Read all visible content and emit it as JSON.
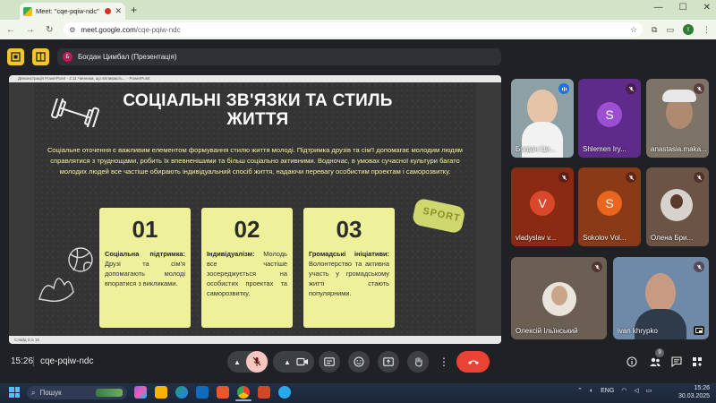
{
  "browser": {
    "tab_title": "Meet: \"cqe-pqiw-ndc\"",
    "new_tab": "+",
    "window_controls": [
      "—",
      "☐",
      "✕"
    ],
    "url_host": "meet.google.com",
    "url_path": "/cqe-pqiw-ndc",
    "profile_initial": "I"
  },
  "meet": {
    "presenter_initial": "Б",
    "presenter_label": "Богдан Цимбал (Презентація)",
    "clock": "15:26",
    "meeting_code": "cqe-pqiw-ndc",
    "people_count": "9"
  },
  "slide": {
    "powerpoint_title": "Демонстрація PowerPoint - 2.11 Чинники, що впливають... - PowerPoint",
    "status_bar": "Слайд 3 із 15",
    "title": "СОЦІАЛЬНІ ЗВ'ЯЗКИ ТА СТИЛЬ ЖИТТЯ",
    "body": "Соціальне оточення є важливим елементом формування стилю життя молоді. Підтримка друзів та сім'ї допомагає молодим людям справлятися з труднощами, робить їх впевненішими та більш соціально активними. Водночас, в умовах сучасної культури багато молодих людей все частіше обирають індивідуальний спосіб життя, надаючи перевагу особистим проектам і саморозвитку.",
    "sticker": "SPORT",
    "cards": [
      {
        "num": "01",
        "heading": "Соціальна підтримка:",
        "text": " Друзі та сім'я допомагають молоді впоратися з викликами."
      },
      {
        "num": "02",
        "heading": "Індивідуалізм:",
        "text": " Молодь все частіше зосереджується на особистих проектах та саморозвитку."
      },
      {
        "num": "03",
        "heading": "Громадські ініціативи:",
        "text": " Волонтерство та активна участь у громадському житті стають популярними."
      }
    ]
  },
  "participants": [
    {
      "name": "Богдан Ци...",
      "initial": ""
    },
    {
      "name": "Shlemen Iry...",
      "initial": "S",
      "avatar_color": "#9c4fd0"
    },
    {
      "name": "anastasia.maka...",
      "initial": ""
    },
    {
      "name": "vladyslav v...",
      "initial": "V",
      "avatar_color": "#d9482a"
    },
    {
      "name": "Sokolov Vol...",
      "initial": "S",
      "avatar_color": "#e8661e"
    },
    {
      "name": "Олена Бри...",
      "initial": ""
    },
    {
      "name": "Олексій Ільїнський",
      "initial": ""
    },
    {
      "name": "ivan khrypko",
      "initial": ""
    }
  ],
  "taskbar": {
    "search_placeholder": "Пошук",
    "lang": "ENG",
    "time": "15:26",
    "date": "30.03.2025"
  },
  "colors": {
    "slide_card": "#eef09a",
    "slide_text": "#f2f2a0",
    "leave_red": "#ea4335",
    "presenter_yellow": "#f4c430"
  }
}
